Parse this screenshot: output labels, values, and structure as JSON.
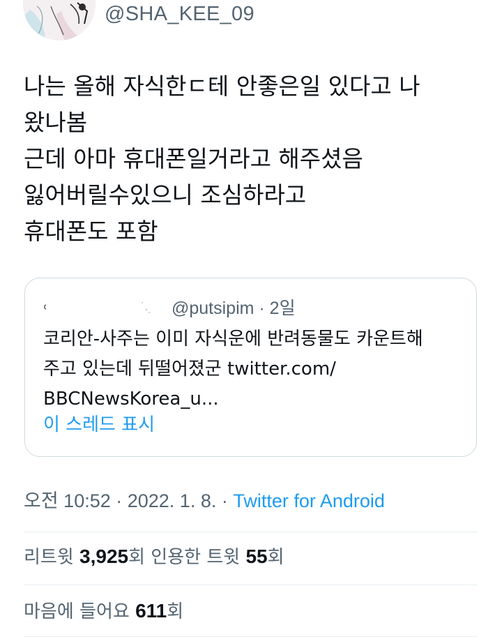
{
  "header": {
    "handle": "@SHA_KEE_09"
  },
  "tweet": {
    "lines": [
      "나는 올해 자식한ㄷ테 안좋은일 있다고 나",
      "왔나봄",
      "근데 아마 휴대폰일거라고 해주셨음",
      "잃어버릴수있으니 조심하라고",
      "휴대폰도 포함"
    ]
  },
  "quote": {
    "handle_time": "@putsipim · 2일",
    "lines": [
      "코리안-사주는 이미 자식운에 반려동물도 카운트해",
      "주고 있는데 뒤떨어졌군 twitter.com/",
      "BBCNewsKorea_u..."
    ],
    "show_thread": "이 스레드 표시"
  },
  "meta": {
    "time_date": "오전 10:52 · 2022. 1. 8. · ",
    "source": "Twitter for Android"
  },
  "stats": {
    "retweet_label": "리트윗 ",
    "retweet_count": "3,925",
    "retweet_suffix": "회  ",
    "quote_label": "인용한 트윗 ",
    "quote_count": "55",
    "quote_suffix": "회",
    "like_label": "마음에 들어요 ",
    "like_count": "611",
    "like_suffix": "회"
  },
  "colors": {
    "text": "#0f1419",
    "secondary": "#536471",
    "link": "#1d9bf0",
    "border": "#cfd9de"
  }
}
